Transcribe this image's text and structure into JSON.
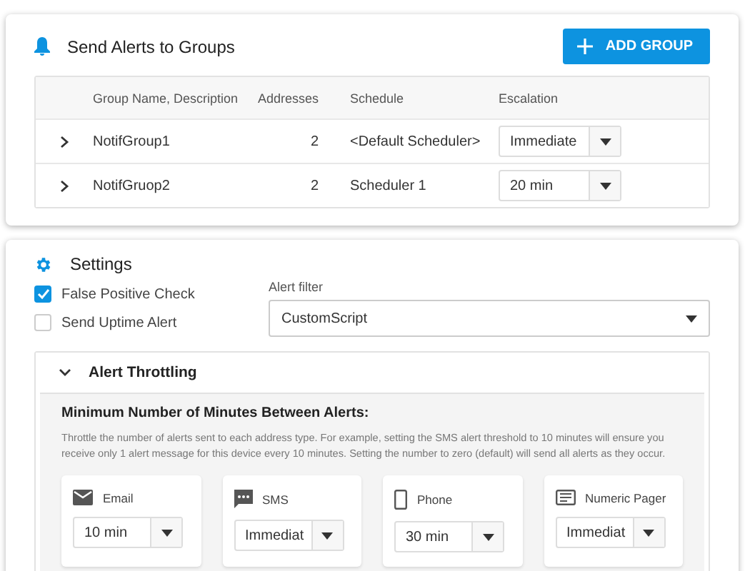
{
  "groups_card": {
    "title": "Send Alerts to Groups",
    "add_button": "ADD GROUP",
    "columns": [
      "Group Name, Description",
      "Addresses",
      "Schedule",
      "Escalation"
    ],
    "rows": [
      {
        "name": "NotifGroup1",
        "addresses": "2",
        "schedule": "<Default Scheduler>",
        "escalation": "Immediate",
        "expanded": false
      },
      {
        "name": "NotifGruop2",
        "addresses": "2",
        "schedule": "Scheduler 1",
        "escalation": "20 min",
        "expanded": false
      }
    ]
  },
  "settings": {
    "title": "Settings",
    "checkboxes": [
      {
        "label": "False Positive Check",
        "checked": true
      },
      {
        "label": "Send Uptime Alert",
        "checked": false
      }
    ],
    "alert_filter": {
      "label": "Alert filter",
      "value": "CustomScript"
    },
    "throttling": {
      "title": "Alert Throttling",
      "expanded": true,
      "heading": "Minimum Number of Minutes Between Alerts:",
      "description": "Throttle the number of alerts sent to each address type. For example, setting the SMS alert threshold to 10 minutes will ensure you receive only 1 alert message for this device every 10 minutes. Setting the number to zero (default) will send all alerts as they occur.",
      "types": [
        {
          "kind": "email",
          "label": "Email",
          "value": "10 min"
        },
        {
          "kind": "sms",
          "label": "SMS",
          "value": "Immediat"
        },
        {
          "kind": "phone",
          "label": "Phone",
          "value": "30 min"
        },
        {
          "kind": "pager",
          "label": "Numeric Pager",
          "value": "Immediat"
        }
      ]
    }
  }
}
